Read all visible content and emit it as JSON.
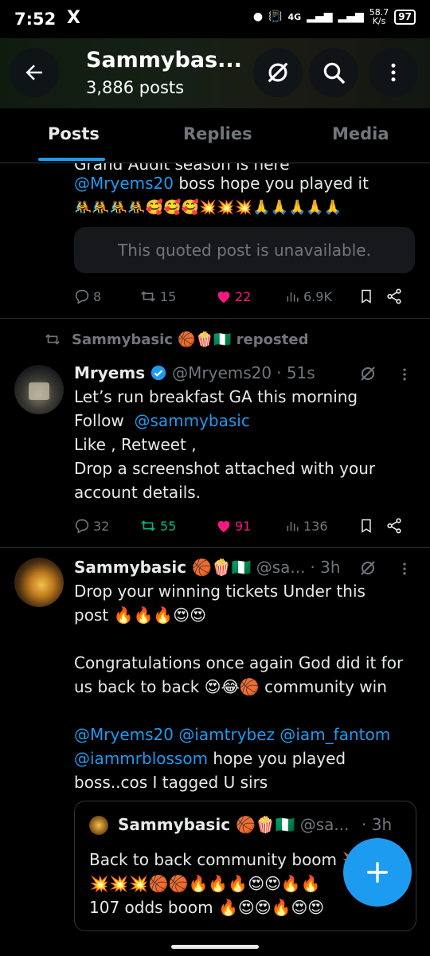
{
  "status_bar": {
    "time": "7:52",
    "app_icon": "X",
    "network_type": "4G",
    "speed_value": "58.7",
    "speed_unit": "K/s",
    "battery": "97"
  },
  "header": {
    "title": "Sammybas...",
    "post_count": "3,886 posts"
  },
  "tabs": [
    {
      "label": "Posts",
      "active": true
    },
    {
      "label": "Replies",
      "active": false
    },
    {
      "label": "Media",
      "active": false
    }
  ],
  "posts": [
    {
      "partial_top_line": "Grand Audit season is here",
      "mention": "@Mryems20",
      "text_after_mention": " boss hope you played it",
      "emoji_line": "🤼🤼🤼🤼🥰🥰🥰💥💥💥🙏🙏🙏🙏🙏",
      "quoted_unavailable": "This quoted post is unavailable.",
      "actions": {
        "replies": "8",
        "reposts": "15",
        "likes": "22",
        "views": "6.9K"
      }
    },
    {
      "repost_label": "Sammybasic 🏀🍿🇳🇬 reposted",
      "author_name": "Mryems",
      "author_handle": "@Mryems20",
      "time": "· 51s",
      "line1": "Let’s run breakfast GA this morning",
      "line2_prefix": "Follow  ",
      "line2_mention": "@sammybasic",
      "line3": "Like , Retweet ,",
      "line4": "Drop a screenshot attached with your",
      "line5": "account details.",
      "actions": {
        "replies": "32",
        "reposts": "55",
        "likes": "91",
        "views": "136"
      }
    },
    {
      "author_name": "Sammybasic 🏀🍿🇳🇬",
      "author_handle": "@sa...",
      "time": "· 3h",
      "line1": "Drop your winning tickets Under this",
      "line2": "post 🔥🔥🔥😍😍",
      "line3": "Congratulations once again God did it for",
      "line4": "us back to back 😍😂🏀 community win",
      "mentions_line1": "@Mryems20 @iamtrybez @iam_fantom",
      "mentions_line2_mention": "@iammrblossom",
      "mentions_line2_text": " hope you played",
      "line_last": "boss..cos I tagged U sirs",
      "quote": {
        "author_name": "Sammybasic 🏀🍿🇳🇬",
        "author_handle": "@sa...",
        "time": "· 3h",
        "line1": "Back to back community boom 💥💥",
        "line2": "💥💥💥🏀🏀🔥🔥🔥😍😍🔥🔥",
        "line3": "107 odds boom 🔥😍😍🔥😍😍"
      }
    }
  ],
  "colors": {
    "accent": "#1d9bf0",
    "like": "#f91880",
    "repost_active": "#00ba7c",
    "muted": "#71767b",
    "background": "#000000"
  },
  "icons": [
    "back-arrow-icon",
    "no-notify-icon",
    "search-icon",
    "more-vertical-icon",
    "reply-icon",
    "repost-icon",
    "heart-icon",
    "views-icon",
    "bookmark-icon",
    "share-icon",
    "verified-icon",
    "grok-icon",
    "compose-plus-icon"
  ]
}
